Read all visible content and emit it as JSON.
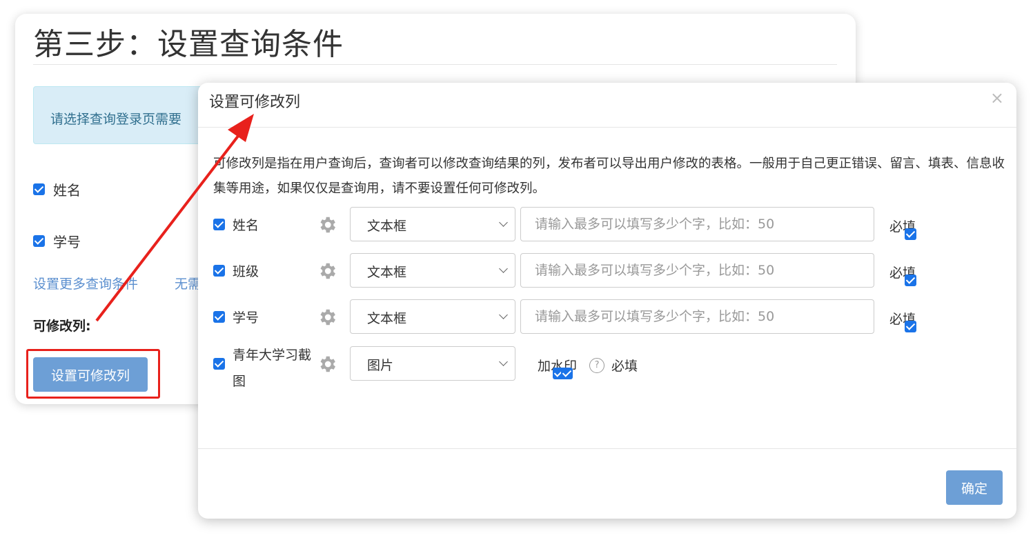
{
  "background": {
    "page_title": "第三步：设置查询条件",
    "alert_text": "请选择查询登录页需要",
    "conditions": [
      {
        "label": "姓名",
        "checked": true
      },
      {
        "label": "学号",
        "checked": true
      }
    ],
    "more_link": "设置更多查询条件",
    "no_need_link": "无需",
    "editable_label": "可修改列:",
    "set_editable_button": "设置可修改列"
  },
  "modal": {
    "title": "设置可修改列",
    "close_icon": "×",
    "description": "可修改列是指在用户查询后，查询者可以修改查询结果的列，发布者可以导出用户修改的表格。一般用于自己更正错误、留言、填表、信息收集等用途，如果仅仅是查询用，请不要设置任何可修改列。",
    "rows": [
      {
        "label": "姓名",
        "type": "文本框",
        "placeholder": "请输入最多可以填写多少个字，比如：50",
        "required_label": "必填"
      },
      {
        "label": "班级",
        "type": "文本框",
        "placeholder": "请输入最多可以填写多少个字，比如：50",
        "required_label": "必填"
      },
      {
        "label": "学号",
        "type": "文本框",
        "placeholder": "请输入最多可以填写多少个字，比如：50",
        "required_label": "必填"
      },
      {
        "label": "青年大学习截图",
        "type": "图片",
        "watermark_label": "加水印",
        "help_icon": "?",
        "required_label": "必填"
      }
    ],
    "confirm_button": "确定"
  },
  "colors": {
    "accent": "#1a73e8",
    "button": "#6d9fd6",
    "annotation_red": "#e8211c"
  }
}
